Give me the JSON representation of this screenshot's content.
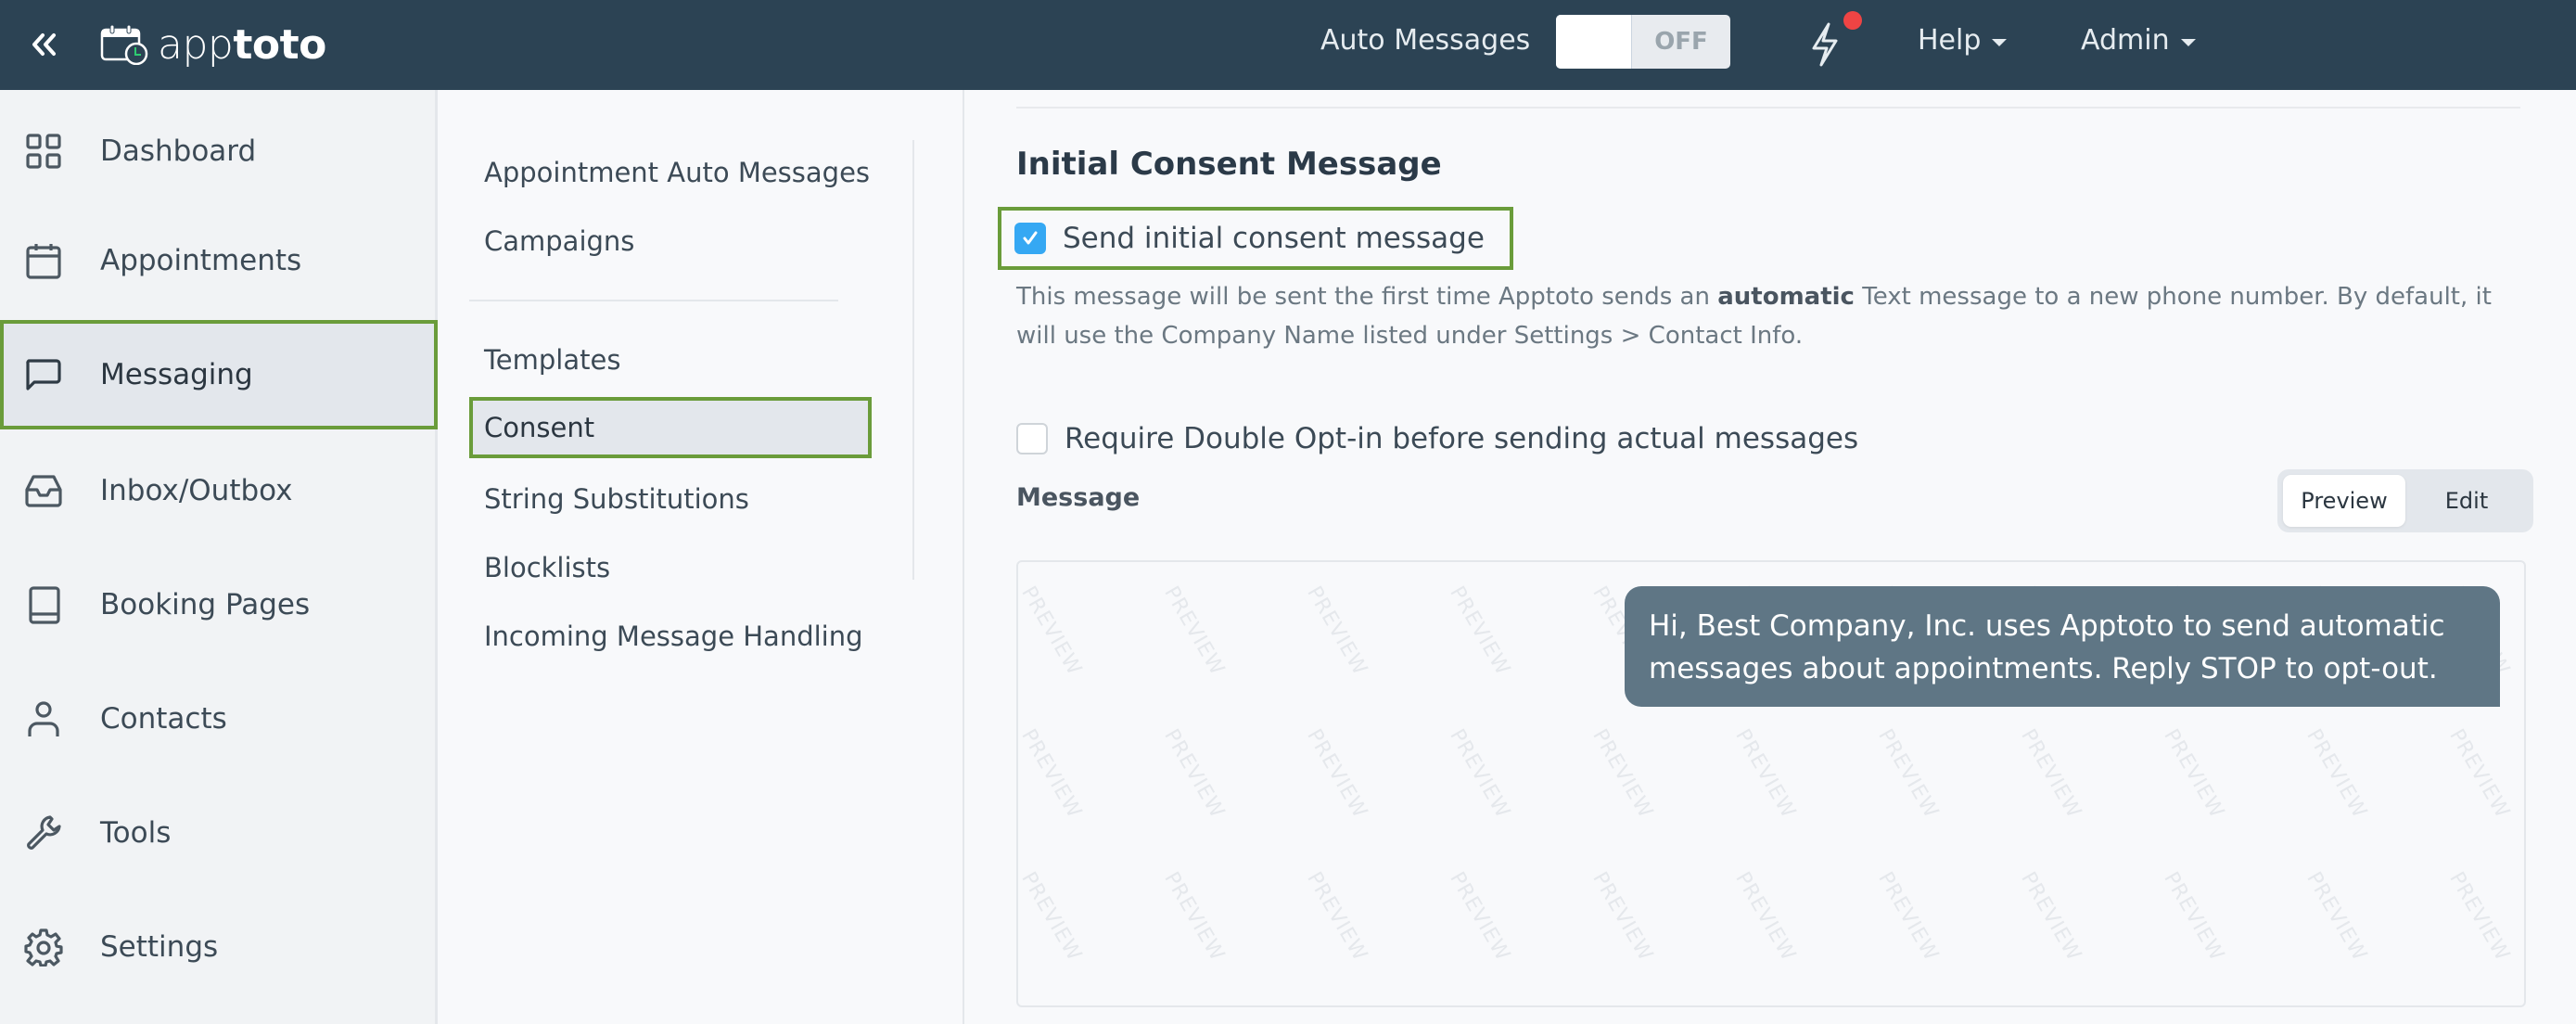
{
  "topbar": {
    "brand_light": "app",
    "brand_bold": "toto",
    "auto_messages_label": "Auto Messages",
    "auto_messages_state": "OFF",
    "help_label": "Help",
    "admin_label": "Admin",
    "notification_badge_color": "#ef4444"
  },
  "sidebar": {
    "items": [
      {
        "label": "Dashboard",
        "icon": "dashboard-grid-icon"
      },
      {
        "label": "Appointments",
        "icon": "calendar-icon"
      },
      {
        "label": "Messaging",
        "icon": "message-bubble-icon",
        "active": true
      },
      {
        "label": "Inbox/Outbox",
        "icon": "inbox-tray-icon"
      },
      {
        "label": "Booking Pages",
        "icon": "book-icon"
      },
      {
        "label": "Contacts",
        "icon": "user-icon"
      },
      {
        "label": "Tools",
        "icon": "wrench-icon"
      },
      {
        "label": "Settings",
        "icon": "gear-icon"
      }
    ]
  },
  "subnav": {
    "group1": [
      "Appointment Auto Messages",
      "Campaigns"
    ],
    "group2": [
      "Templates",
      "Consent",
      "String Substitutions",
      "Blocklists",
      "Incoming Message Handling"
    ],
    "active": "Consent"
  },
  "main": {
    "section_title": "Initial Consent Message",
    "send_initial": {
      "label": "Send initial consent message",
      "checked": true
    },
    "help_text_before": "This message will be sent the first time Apptoto sends an ",
    "help_text_bold": "automatic",
    "help_text_after": " Text message to a new phone number. By default, it will use the Company Name listed under Settings > Contact Info.",
    "double_optin": {
      "label": "Require Double Opt-in before sending actual messages",
      "checked": false
    },
    "message_label": "Message",
    "tabs": {
      "preview": "Preview",
      "edit": "Edit",
      "active": "Preview"
    },
    "watermark_text": "PREVIEW",
    "preview_message": "Hi, Best Company, Inc. uses Apptoto to send automatic messages about appointments. Reply STOP to opt-out."
  },
  "colors": {
    "topbar": "#2c4354",
    "highlight_border": "#6a9c3a",
    "checkbox_checked": "#35a8f3",
    "bubble": "#5f7685"
  }
}
